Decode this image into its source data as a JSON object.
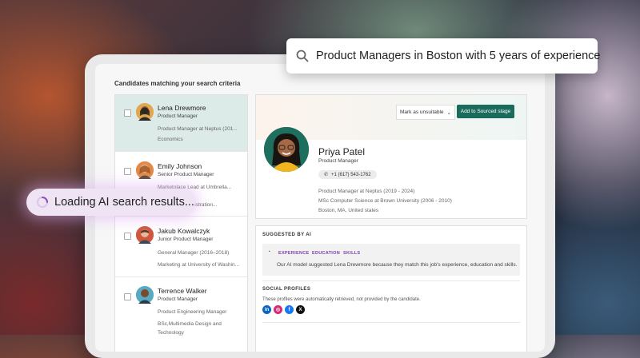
{
  "search": {
    "query": "Product Managers in Boston with 5 years of experience",
    "icon": "search-icon"
  },
  "loading": {
    "text": "Loading AI search results..."
  },
  "panel": {
    "title": "Candidates matching your search criteria"
  },
  "candidates": [
    {
      "name": "Lena Drewmore",
      "role": "Product Manager",
      "detail1": "Product Manager at Neptus (201...",
      "detail2": "Economics",
      "selected": true
    },
    {
      "name": "Emily Johnson",
      "role": "Senior Product Manager",
      "detail1": "Marketolace Lead at Umbrella...",
      "detail2": "Business Administration..."
    },
    {
      "name": "Jakub Kowalczyk",
      "role": "Junior Product Manager",
      "detail1": "General Manager (2016–2018)",
      "detail2": "Marketing at University of Washin..."
    },
    {
      "name": "Terrence Walker",
      "role": "Product Manager",
      "detail1": "Product Engineering Manager",
      "detail2": "BSc,Multimedia Design and",
      "detail3": "Technology"
    }
  ],
  "profile": {
    "mark_label": "Mark as unsuitable",
    "add_label": "Add to Sourced stage",
    "name": "Priya Patel",
    "role": "Product Manager",
    "phone": "+1 (617) 543-1762",
    "lines": [
      "Product Manager at Neptus (2019 - 2024)",
      "MSc Computer Science at Brown University (2006 - 2010)",
      "Boston, MA, United states"
    ]
  },
  "ai": {
    "section": "SUGGESTED BY AI",
    "tags": [
      "EXPERIENCE",
      "EDUCATION",
      "SKILLS"
    ],
    "text": "Our AI model suggested Lena Drewmore because they match this job's experience, education and skills."
  },
  "social": {
    "section": "SOCIAL PROFILES",
    "note": "These profiles were automatically retrieved, not provided by the candidate.",
    "icons": [
      {
        "name": "linkedin-icon",
        "glyph": "in",
        "color": "#0a66c2"
      },
      {
        "name": "instagram-icon",
        "glyph": "◎",
        "color": "#d62976"
      },
      {
        "name": "facebook-icon",
        "glyph": "f",
        "color": "#1877f2"
      },
      {
        "name": "x-icon",
        "glyph": "X",
        "color": "#111111"
      }
    ]
  },
  "colors": {
    "accent": "#1a6b5c",
    "selected_row": "#dcebe8",
    "ai_tag": "#7a3fa8"
  }
}
